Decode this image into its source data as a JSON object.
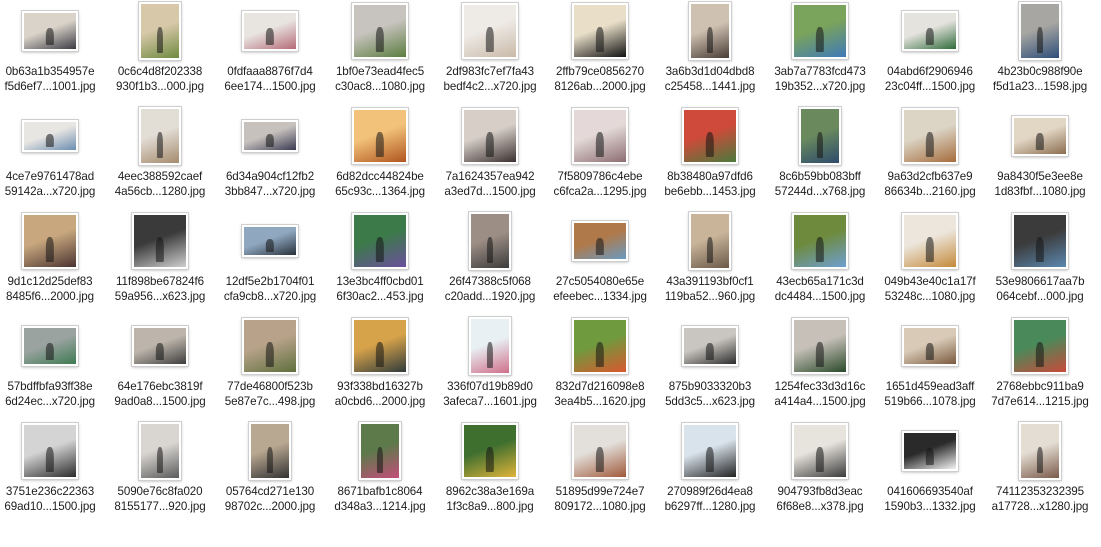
{
  "files": [
    {
      "line1": "0b63a1b354957e",
      "line2": "f5d6ef7...1001.jpg",
      "orientation": "landscape",
      "colors": [
        "#3b3b44",
        "#d9d3c9"
      ]
    },
    {
      "line1": "0c6c4d8f202338",
      "line2": "930f1b3...000.jpg",
      "orientation": "portrait",
      "colors": [
        "#6f8a3f",
        "#d7c8a9"
      ]
    },
    {
      "line1": "0fdfaaa8876f7d4",
      "line2": "6ee174...1500.jpg",
      "orientation": "landscape",
      "colors": [
        "#b56b77",
        "#e8e4e0"
      ]
    },
    {
      "line1": "1bf0e73ead4fec5",
      "line2": "c30ac8...1080.jpg",
      "orientation": "square",
      "colors": [
        "#5b7d3f",
        "#c7c3be"
      ]
    },
    {
      "line1": "2df983fc7ef7fa43",
      "line2": "bedf4c2...x720.jpg",
      "orientation": "square",
      "colors": [
        "#c9b9a8",
        "#eeeae5"
      ]
    },
    {
      "line1": "2ffb79ce0856270",
      "line2": "8126ab...2000.jpg",
      "orientation": "square",
      "colors": [
        "#111111",
        "#e9dfc9"
      ]
    },
    {
      "line1": "3a6b3d1d04dbd8",
      "line2": "c25458...1441.jpg",
      "orientation": "portrait",
      "colors": [
        "#4a3d36",
        "#cfc1b2"
      ]
    },
    {
      "line1": "3ab7a7783fcd473",
      "line2": "19b352...x720.jpg",
      "orientation": "square",
      "colors": [
        "#3f7ab8",
        "#7aa35b"
      ]
    },
    {
      "line1": "04abd6f2906946",
      "line2": "23c04ff...1500.jpg",
      "orientation": "landscape",
      "colors": [
        "#2f6b3a",
        "#e5e3de"
      ]
    },
    {
      "line1": "4b23b0c988f90e",
      "line2": "f5d1a23...1598.jpg",
      "orientation": "portrait",
      "colors": [
        "#2e4e78",
        "#a7a6a2"
      ]
    },
    {
      "line1": "4ce7e9761478ad",
      "line2": "59142a...x720.jpg",
      "orientation": "wide",
      "colors": [
        "#6b8db0",
        "#e8e6e3"
      ]
    },
    {
      "line1": "4eec388592caef",
      "line2": "4a56cb...1280.jpg",
      "orientation": "portrait",
      "colors": [
        "#a58b6e",
        "#e2ddd5"
      ]
    },
    {
      "line1": "6d34a904cf12fb2",
      "line2": "3bb847...x720.jpg",
      "orientation": "wide",
      "colors": [
        "#3a3a52",
        "#c6c1bd"
      ]
    },
    {
      "line1": "6d82dcc44824be",
      "line2": "65c93c...1364.jpg",
      "orientation": "square",
      "colors": [
        "#b0551e",
        "#f2c27a"
      ]
    },
    {
      "line1": "7a1624357ea942",
      "line2": "a3ed7d...1500.jpg",
      "orientation": "square",
      "colors": [
        "#3b3030",
        "#d6cec7"
      ]
    },
    {
      "line1": "7f5809786c4ebe",
      "line2": "c6fca2a...1295.jpg",
      "orientation": "square",
      "colors": [
        "#8c6d72",
        "#e4d9d8"
      ]
    },
    {
      "line1": "8b38480a97dfd6",
      "line2": "be6ebb...1453.jpg",
      "orientation": "square",
      "colors": [
        "#4b7a3c",
        "#cf4a3a"
      ]
    },
    {
      "line1": "8c6b59bb083bff",
      "line2": "57244d...x768.jpg",
      "orientation": "portrait",
      "colors": [
        "#2e4b6b",
        "#6a8a5e"
      ]
    },
    {
      "line1": "9a63d2cfb637e9",
      "line2": "86634b...2160.jpg",
      "orientation": "square",
      "colors": [
        "#a56c3c",
        "#dcd5c6"
      ]
    },
    {
      "line1": "9a8430f5e3ee8e",
      "line2": "1d83fbf...1080.jpg",
      "orientation": "landscape",
      "colors": [
        "#8a6d4f",
        "#e2d6c4"
      ]
    },
    {
      "line1": "9d1c12d25def83",
      "line2": "8485f6...2000.jpg",
      "orientation": "square",
      "colors": [
        "#4a3430",
        "#c8a77e"
      ]
    },
    {
      "line1": "11f898be67824f6",
      "line2": "59a956...x623.jpg",
      "orientation": "square",
      "colors": [
        "#cfcfcf",
        "#3a3a3a"
      ]
    },
    {
      "line1": "12df5e2b1704f01",
      "line2": "cfa9cb8...x720.jpg",
      "orientation": "wide",
      "colors": [
        "#28303a",
        "#8fa7bf"
      ]
    },
    {
      "line1": "13e3bc4ff0cbd01",
      "line2": "6f30ac2...453.jpg",
      "orientation": "square",
      "colors": [
        "#6a4f9c",
        "#3c7a4a"
      ]
    },
    {
      "line1": "26f47388c5f068",
      "line2": "c20add...1920.jpg",
      "orientation": "portrait",
      "colors": [
        "#3b3b3b",
        "#9c8e84"
      ]
    },
    {
      "line1": "27c5054080e65e",
      "line2": "efeebec...1334.jpg",
      "orientation": "landscape",
      "colors": [
        "#6a9ac0",
        "#b0794a"
      ]
    },
    {
      "line1": "43a391193bf0cf1",
      "line2": "119ba52...960.jpg",
      "orientation": "portrait",
      "colors": [
        "#6b5a49",
        "#c9b49a"
      ]
    },
    {
      "line1": "43ecb65a171c3d",
      "line2": "dc4484...1500.jpg",
      "orientation": "square",
      "colors": [
        "#6e9fd1",
        "#6e8a3c"
      ]
    },
    {
      "line1": "049b43e40c1a17f",
      "line2": "53248c...1080.jpg",
      "orientation": "square",
      "colors": [
        "#c48a3a",
        "#ece6dc"
      ]
    },
    {
      "line1": "53e9806617aa7b",
      "line2": "064cebf...000.jpg",
      "orientation": "square",
      "colors": [
        "#5b88b0",
        "#3b3b3b"
      ]
    },
    {
      "line1": "57bdffbfa93ff38e",
      "line2": "6d24ec...x720.jpg",
      "orientation": "landscape",
      "colors": [
        "#3e7a52",
        "#9aa3a0"
      ]
    },
    {
      "line1": "64e176ebc3819f",
      "line2": "9ad0a8...1500.jpg",
      "orientation": "landscape",
      "colors": [
        "#3d3d3d",
        "#bdb5ab"
      ]
    },
    {
      "line1": "77de46800f523b",
      "line2": "5e87e7c...498.jpg",
      "orientation": "square",
      "colors": [
        "#5f6f3c",
        "#b8a38a"
      ]
    },
    {
      "line1": "93f338bd16327b",
      "line2": "a0cbd6...2000.jpg",
      "orientation": "square",
      "colors": [
        "#2f3b3b",
        "#d6a24a"
      ]
    },
    {
      "line1": "336f07d19b89d0",
      "line2": "3afeca7...1601.jpg",
      "orientation": "portrait",
      "colors": [
        "#cf6f8a",
        "#e8f0f3"
      ]
    },
    {
      "line1": "832d7d216098e8",
      "line2": "3ea4b5...1620.jpg",
      "orientation": "square",
      "colors": [
        "#d9582e",
        "#6f9a3e"
      ]
    },
    {
      "line1": "875b9033320b3",
      "line2": "5dd3c5...x623.jpg",
      "orientation": "landscape",
      "colors": [
        "#2c2c2c",
        "#c9c5c0"
      ]
    },
    {
      "line1": "1254fec33d3d16c",
      "line2": "a414a4...1500.jpg",
      "orientation": "square",
      "colors": [
        "#2a4a2a",
        "#c6c0b8"
      ]
    },
    {
      "line1": "1651d459ead3aff",
      "line2": "519b66...1078.jpg",
      "orientation": "landscape",
      "colors": [
        "#7a5a3e",
        "#d8cab6"
      ]
    },
    {
      "line1": "2768ebbc911ba9",
      "line2": "7d7e614...1215.jpg",
      "orientation": "square",
      "colors": [
        "#c94a3a",
        "#4a8a5a"
      ]
    },
    {
      "line1": "3751e236c22363",
      "line2": "69ad10...1500.jpg",
      "orientation": "square",
      "colors": [
        "#2b2b2b",
        "#d4d4d4"
      ]
    },
    {
      "line1": "5090e76c8fa020",
      "line2": "8155177...920.jpg",
      "orientation": "portrait",
      "colors": [
        "#5b5b5b",
        "#d9d6d2"
      ]
    },
    {
      "line1": "05764cd271e130",
      "line2": "98702c...2000.jpg",
      "orientation": "portrait",
      "colors": [
        "#333333",
        "#b9a891"
      ]
    },
    {
      "line1": "8671bafb1c8064",
      "line2": "d348a3...1214.jpg",
      "orientation": "portrait",
      "colors": [
        "#c34f7a",
        "#5c7a4a"
      ]
    },
    {
      "line1": "8962c38a3e169a",
      "line2": "1f3c8a9...800.jpg",
      "orientation": "square",
      "colors": [
        "#e0b43a",
        "#3f6f2f"
      ]
    },
    {
      "line1": "51895d99e724e7",
      "line2": "809172...1080.jpg",
      "orientation": "square",
      "colors": [
        "#a05a3a",
        "#e3e0dc"
      ]
    },
    {
      "line1": "270989f26d4ea8",
      "line2": "b6297ff...1280.jpg",
      "orientation": "square",
      "colors": [
        "#222222",
        "#d9e3ec"
      ]
    },
    {
      "line1": "904793fb8d3eac",
      "line2": "6f68e8...x378.jpg",
      "orientation": "square",
      "colors": [
        "#3b3b3b",
        "#e7e3dd"
      ]
    },
    {
      "line1": "041606693540af",
      "line2": "1590b3...1332.jpg",
      "orientation": "landscape",
      "colors": [
        "#f3f3f3",
        "#2a2a2a"
      ]
    },
    {
      "line1": "74112353232395",
      "line2": "a17728...x1280.jpg",
      "orientation": "portrait",
      "colors": [
        "#7a5a4a",
        "#e4ddd3"
      ]
    }
  ]
}
